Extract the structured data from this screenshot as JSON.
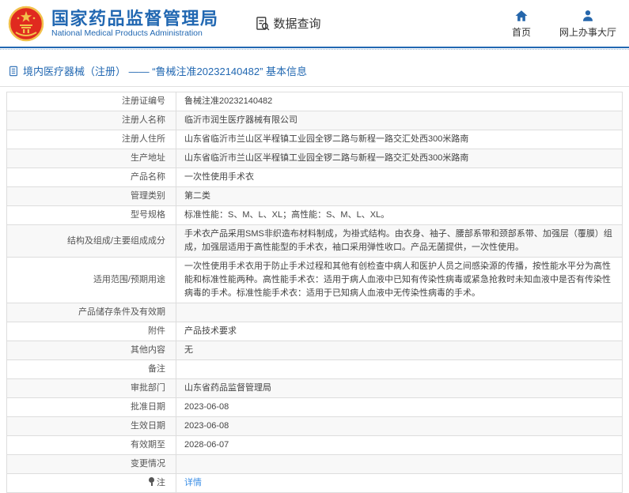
{
  "header": {
    "org_name_cn": "国家药品监督管理局",
    "org_name_en": "National Medical Products Administration",
    "data_query_label": "数据查询",
    "nav": [
      {
        "label": "首页",
        "icon": "home-icon"
      },
      {
        "label": "网上办事大厅",
        "icon": "person-icon"
      }
    ]
  },
  "breadcrumb": {
    "text": "境内医疗器械（注册） —— “鲁械注准20232140482” 基本信息"
  },
  "table": {
    "rows": [
      {
        "label": "注册证编号",
        "value": "鲁械注准20232140482"
      },
      {
        "label": "注册人名称",
        "value": "临沂市润生医疗器械有限公司"
      },
      {
        "label": "注册人住所",
        "value": "山东省临沂市兰山区半程镇工业园全锣二路与新程一路交汇处西300米路南"
      },
      {
        "label": "生产地址",
        "value": "山东省临沂市兰山区半程镇工业园全锣二路与新程一路交汇处西300米路南"
      },
      {
        "label": "产品名称",
        "value": "一次性使用手术衣"
      },
      {
        "label": "管理类别",
        "value": "第二类"
      },
      {
        "label": "型号规格",
        "value": "标准性能：S、M、L、XL；高性能：S、M、L、XL。"
      },
      {
        "label": "结构及组成/主要组成成分",
        "value": "手术衣产品采用SMS非织造布材料制成，为褂式结构。由衣身、袖子、腰部系带和颈部系带、加强层（覆膜）组成，加强层适用于高性能型的手术衣，袖口采用弹性收口。产品无菌提供，一次性使用。"
      },
      {
        "label": "适用范围/预期用途",
        "value": "一次性使用手术衣用于防止手术过程和其他有创检查中病人和医护人员之间感染源的传播，按性能水平分为高性能和标准性能两种。高性能手术衣：适用于病人血液中已知有传染性病毒或紧急抢救时未知血液中是否有传染性病毒的手术。标准性能手术衣：适用于已知病人血液中无传染性病毒的手术。"
      },
      {
        "label": "产品储存条件及有效期",
        "value": ""
      },
      {
        "label": "附件",
        "value": "产品技术要求"
      },
      {
        "label": "其他内容",
        "value": "无"
      },
      {
        "label": "备注",
        "value": ""
      },
      {
        "label": "审批部门",
        "value": "山东省药品监督管理局"
      },
      {
        "label": "批准日期",
        "value": "2023-06-08"
      },
      {
        "label": "生效日期",
        "value": "2023-06-08"
      },
      {
        "label": "有效期至",
        "value": "2028-06-07"
      },
      {
        "label": "变更情况",
        "value": ""
      },
      {
        "label": "注",
        "value": "详情",
        "label_icon": "bulb-icon",
        "link": true
      }
    ]
  },
  "colors": {
    "brand_blue": "#2268b2",
    "emblem_red": "#e02a1f",
    "emblem_gold": "#f2c14b",
    "link_blue": "#3a8ee6",
    "row_alt": "#f8f8f8",
    "border_gray": "#dddddd"
  }
}
